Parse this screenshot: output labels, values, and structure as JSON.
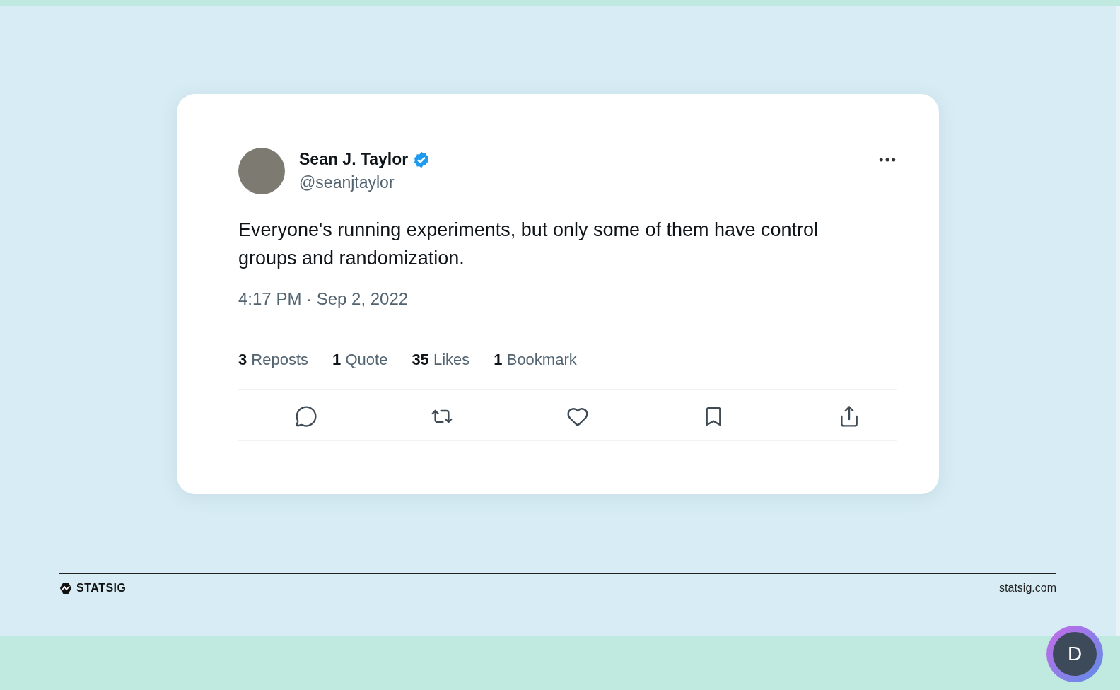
{
  "tweet": {
    "author": {
      "name": "Sean J. Taylor",
      "verified": true,
      "handle": "@seanjtaylor"
    },
    "text": "Everyone's running experiments, but only some of them have control groups and randomization.",
    "timestamp": "4:17 PM · Sep 2, 2022",
    "stats": [
      {
        "text": "**3** Reposts"
      },
      {
        "text": "**1** Quote"
      },
      {
        "text": "**35** Likes"
      },
      {
        "text": "**1** Bookmark"
      }
    ]
  },
  "footer": {
    "brand": "STATSIG",
    "url": "statsig.com"
  },
  "participant": {
    "initial": "D"
  }
}
